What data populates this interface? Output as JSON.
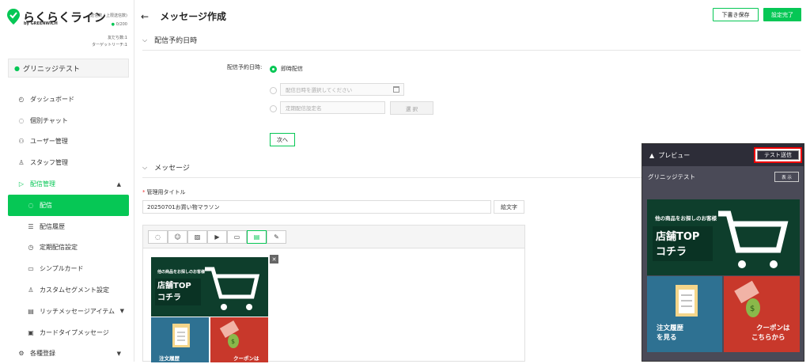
{
  "sidebar": {
    "logo_text": "らくらくライン",
    "logo_sub": "by GREENWICH",
    "count_label": "(送信数 / 上限送信数)",
    "count_value": "0/200",
    "friends": "友だち数:1",
    "target_reach": "ターゲットリーチ:1",
    "account_name": "グリニッジテスト",
    "nav": [
      {
        "label": "ダッシュボード",
        "icon": "dashboard-icon"
      },
      {
        "label": "個別チャット",
        "icon": "chat-icon"
      },
      {
        "label": "ユーザー管理",
        "icon": "users-icon"
      },
      {
        "label": "スタッフ管理",
        "icon": "staff-icon"
      },
      {
        "label": "配信管理",
        "icon": "send-icon"
      },
      {
        "label": "配信",
        "icon": "message-icon"
      },
      {
        "label": "配信履歴",
        "icon": "history-icon"
      },
      {
        "label": "定期配信設定",
        "icon": "clock-icon"
      },
      {
        "label": "シンプルカード",
        "icon": "folder-icon"
      },
      {
        "label": "カスタムセグメント設定",
        "icon": "segment-icon"
      },
      {
        "label": "リッチメッセージアイテム",
        "icon": "rich-message-icon"
      },
      {
        "label": "カードタイプメッセージ",
        "icon": "card-type-icon"
      },
      {
        "label": "各種登録",
        "icon": "gear-icon"
      }
    ]
  },
  "header": {
    "back": "←",
    "title": "メッセージ作成",
    "draft_label": "下書き保存",
    "done_label": "設定完了"
  },
  "schedule": {
    "section_title": "配信予約日時",
    "label": "配信予約日時:",
    "option_immediate": "即時配信",
    "date_placeholder": "配信日時を選択してください",
    "periodic_placeholder": "定期配信設定名",
    "select_label": "選 択",
    "next_label": "次へ"
  },
  "message": {
    "section_title": "メッセージ",
    "title_label": "管理用タイトル",
    "title_value": "20250701お買い物マラソン",
    "emoji_label": "絵文字"
  },
  "card": {
    "banner_small": "他の商品をお探しのお客様",
    "banner_big_1": "店舗TOP",
    "banner_big_2": "コチラ",
    "left_1": "注文履歴",
    "left_2": "を見る",
    "right_1": "クーポンは",
    "right_2": "こちらから"
  },
  "preview": {
    "title": "プレビュー",
    "test_send": "テスト送信",
    "account": "グリニッジテスト",
    "show": "表 示"
  },
  "colors": {
    "brand_green": "#06c755",
    "card_dark_green": "#0e3e2c",
    "card_blue": "#2e7192",
    "card_red": "#c8382b",
    "highlight_red": "#e00000"
  }
}
